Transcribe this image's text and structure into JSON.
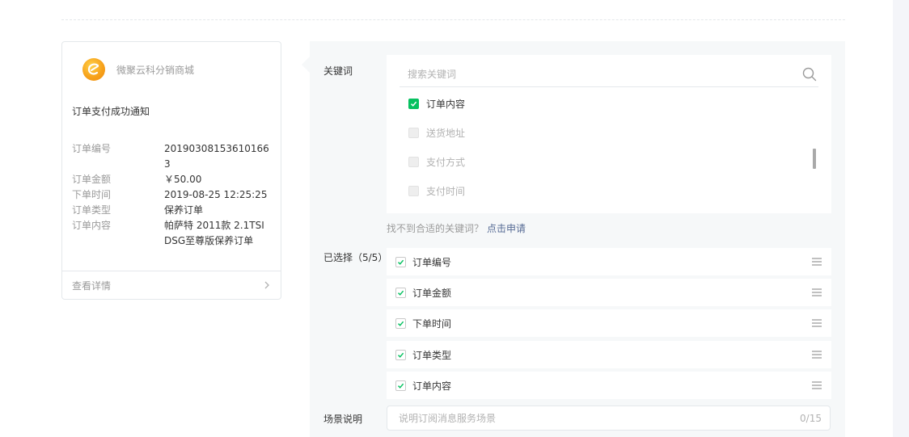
{
  "preview": {
    "account_name": "微聚云科分销商城",
    "title": "订单支付成功通知",
    "fields": [
      {
        "label": "订单编号",
        "value": "201903081536101663"
      },
      {
        "label": "订单金额",
        "value": "￥50.00"
      },
      {
        "label": "下单时间",
        "value": "2019-08-25 12:25:25"
      },
      {
        "label": "订单类型",
        "value": "保养订单"
      },
      {
        "label": "订单内容",
        "value": "帕萨特 2011款 2.1TSI DSG至尊版保养订单"
      }
    ],
    "footer_link": "查看详情"
  },
  "keywords": {
    "label": "关键词",
    "search_placeholder": "搜索关键词",
    "items": [
      {
        "text": "订单内容",
        "checked": true,
        "disabled": false
      },
      {
        "text": "送货地址",
        "checked": false,
        "disabled": true
      },
      {
        "text": "支付方式",
        "checked": false,
        "disabled": true
      },
      {
        "text": "支付时间",
        "checked": false,
        "disabled": true
      }
    ],
    "hint_text": "找不到合适的关键词？",
    "hint_link": "点击申请"
  },
  "selected": {
    "label": "已选择（5/5）",
    "items": [
      "订单编号",
      "订单金额",
      "下单时间",
      "订单类型",
      "订单内容"
    ]
  },
  "scene": {
    "label": "场景说明",
    "placeholder": "说明订阅消息服务场景",
    "counter": "0/15"
  },
  "colors": {
    "accent": "#07c160",
    "link": "#576b95",
    "logo": "#f7a21b"
  }
}
